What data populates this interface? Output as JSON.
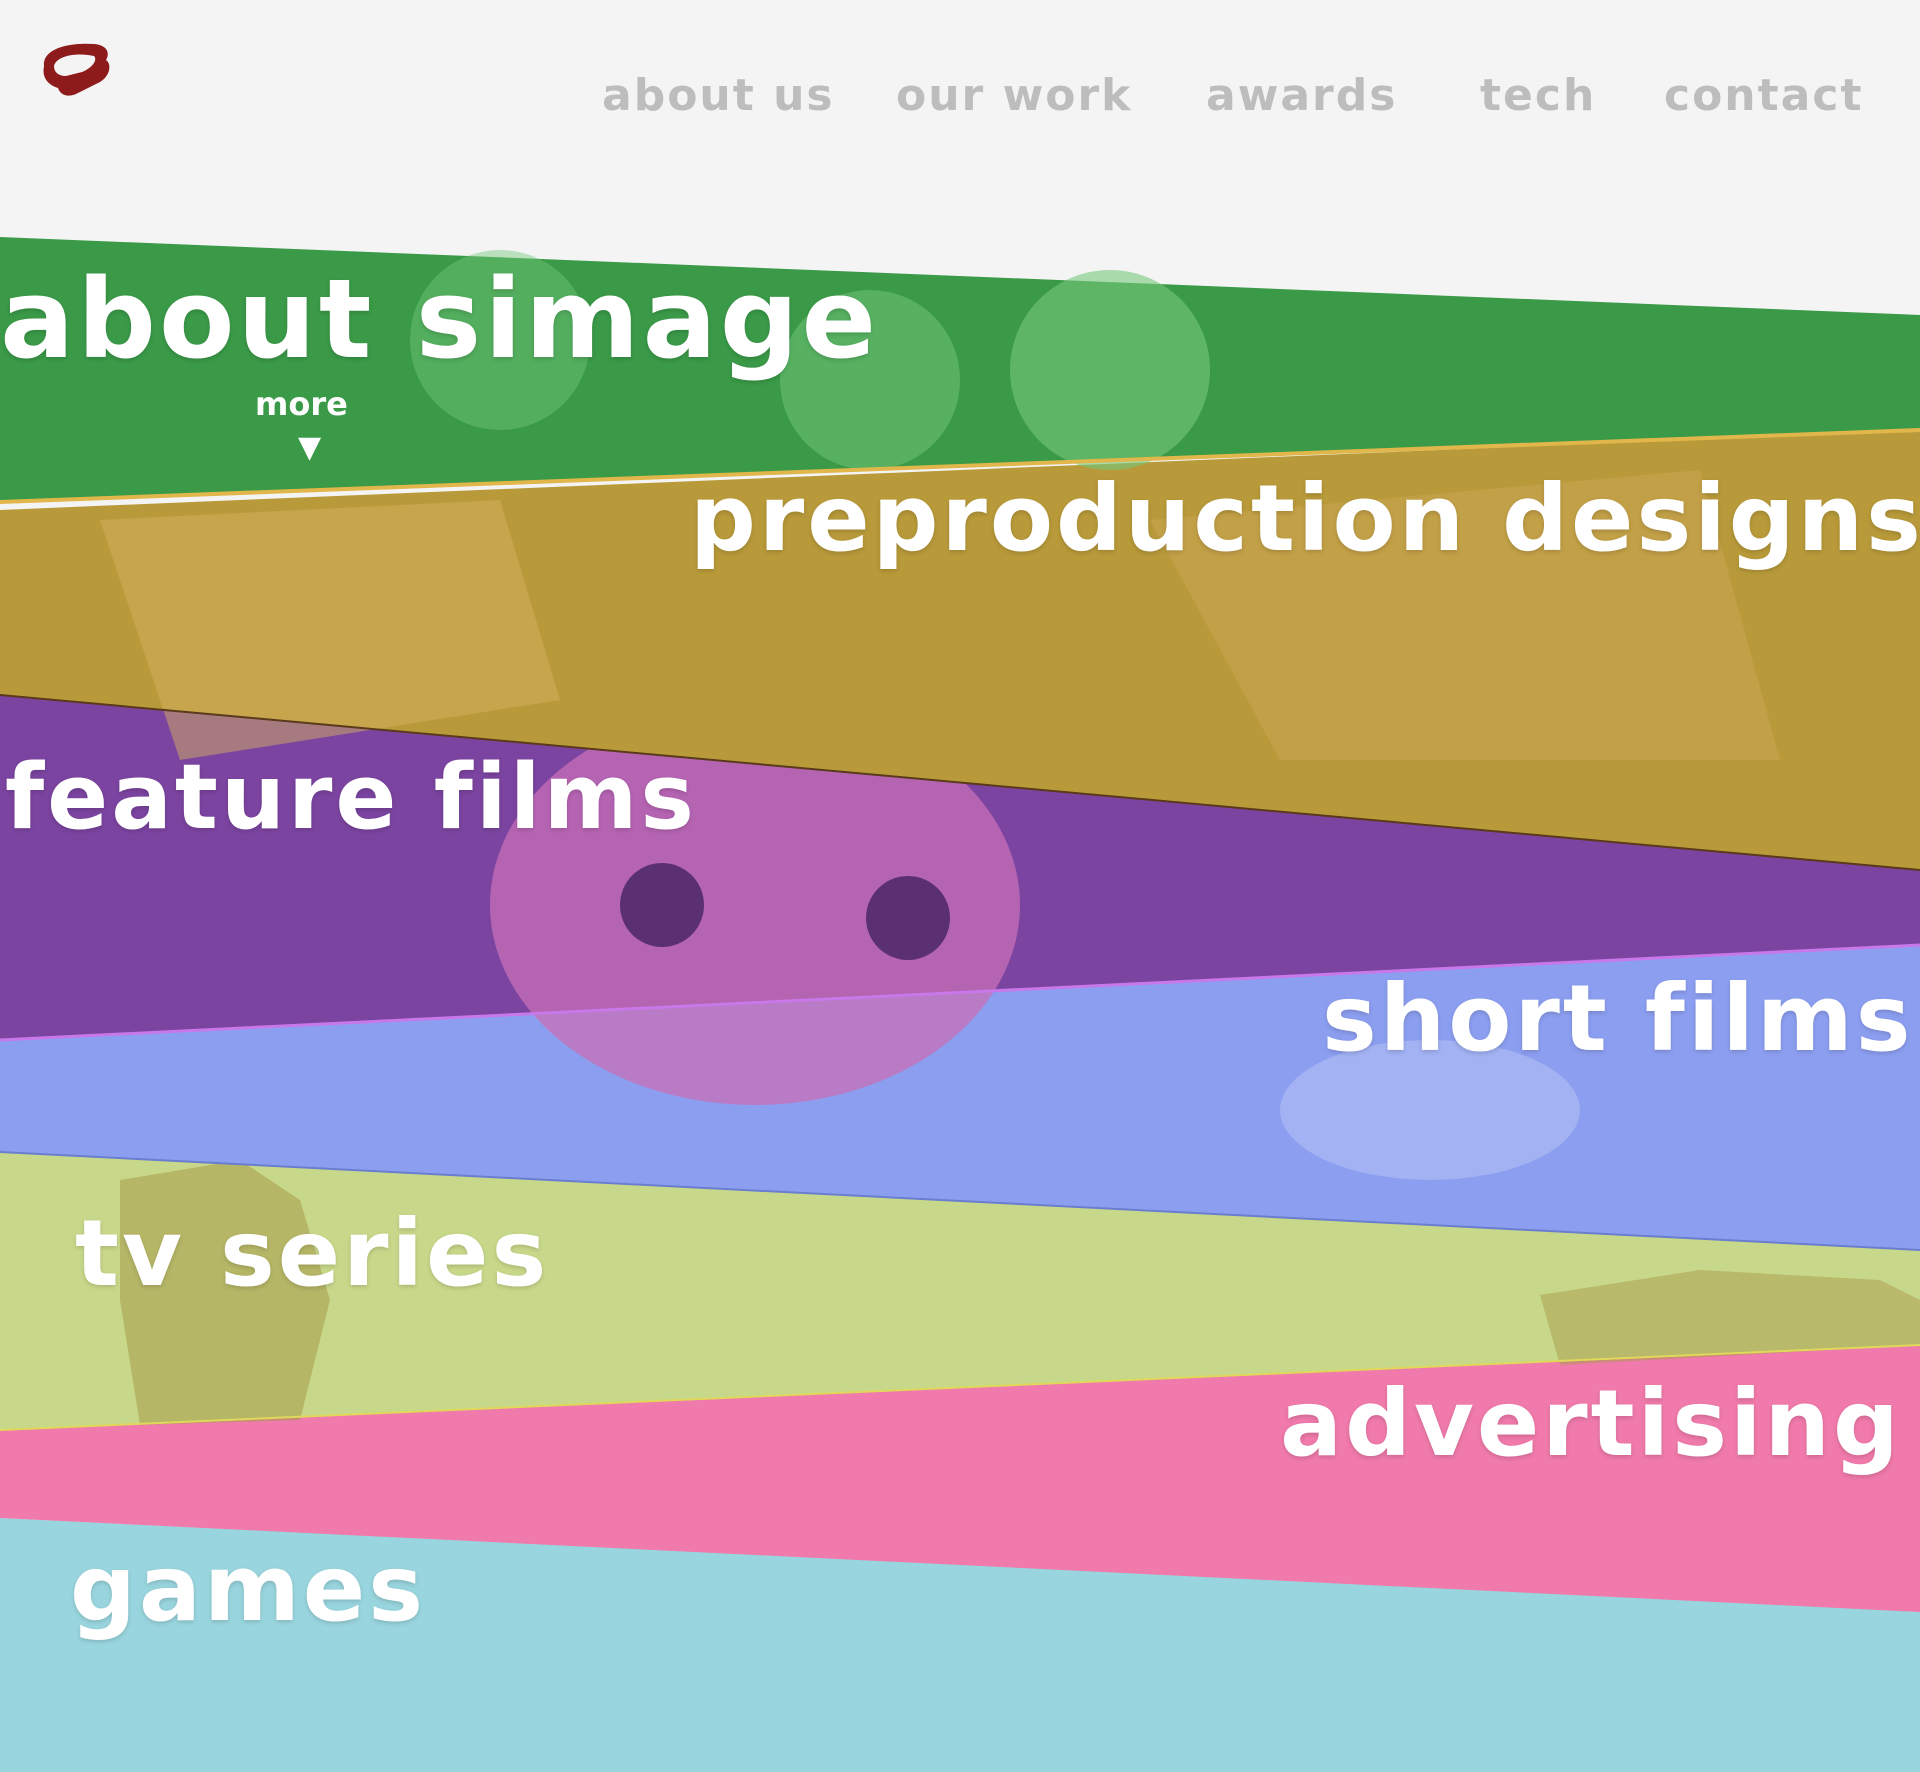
{
  "header": {
    "logo_icon": "simage-logo-icon",
    "logo_color": "#8e1b1b",
    "nav": [
      {
        "label": "about us"
      },
      {
        "label": "our work"
      },
      {
        "label": "awards"
      },
      {
        "label": "tech"
      },
      {
        "label": "contact"
      }
    ]
  },
  "bands": [
    {
      "label": "about simage",
      "color": "#3a9a48",
      "more": "more",
      "more_icon": "triangle-down-icon"
    },
    {
      "label": "preproduction designs",
      "color": "#b89a3a"
    },
    {
      "label": "feature films",
      "color": "#7b44a0"
    },
    {
      "label": "short films",
      "color": "#8c9ef0"
    },
    {
      "label": "tv series",
      "color": "#c8d88a"
    },
    {
      "label": "advertising",
      "color": "#f07aab"
    },
    {
      "label": "games",
      "color": "#99d5de"
    }
  ]
}
